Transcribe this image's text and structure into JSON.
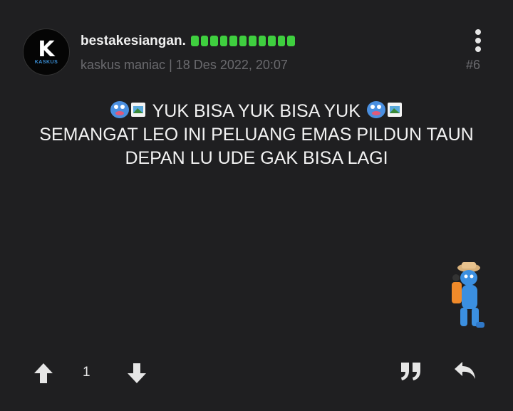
{
  "post": {
    "username": "bestakesiangan.",
    "rank": "kaskus maniac",
    "separator": "|",
    "date": "18 Des 2022, 20:07",
    "post_number": "#6",
    "reputation_bars": 11,
    "lines": [
      "YUK BISA YUK BISA YUK",
      "SEMANGAT LEO INI PELUANG EMAS PILDUN TAUN",
      "DEPAN LU UDE GAK BISA LAGI"
    ]
  },
  "avatar": {
    "logo_text": "K",
    "brand_text": "KASKUS"
  },
  "actions": {
    "vote_count": "1"
  },
  "colors": {
    "background": "#1f1f21",
    "reputation": "#3fcf3f",
    "muted": "#6a6a6e"
  },
  "icons": [
    "kebab-menu-icon",
    "upvote-icon",
    "downvote-icon",
    "quote-icon",
    "reply-icon",
    "emoticon-icon",
    "sticker-icon"
  ]
}
